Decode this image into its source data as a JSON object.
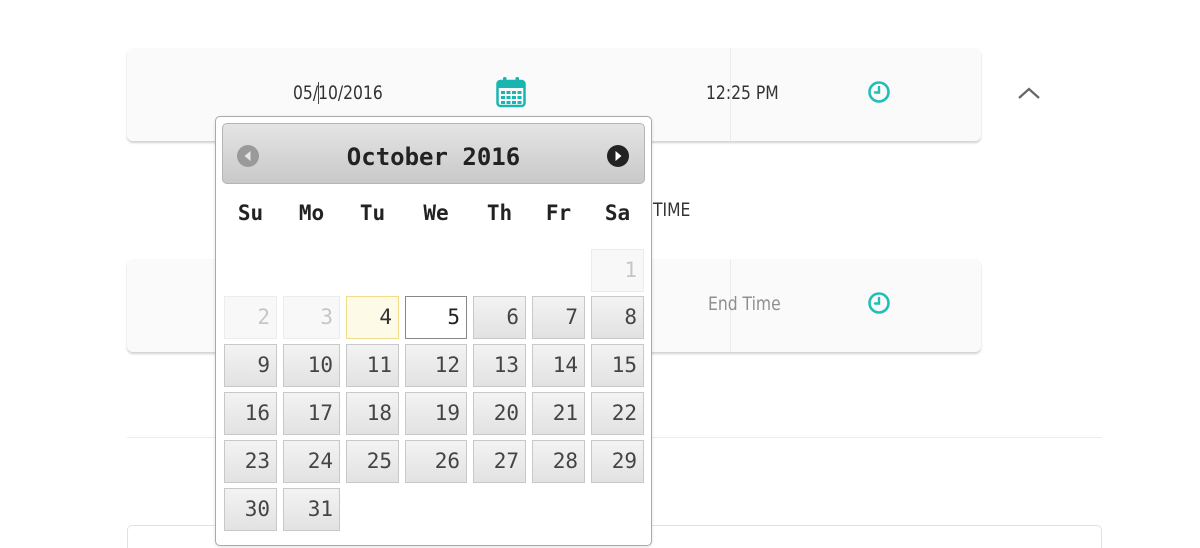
{
  "start": {
    "date_value": "05/10/2016",
    "time_value": "12:25 PM",
    "icons": {
      "calendar": "calendar-icon",
      "clock": "clock-icon",
      "collapse": "chevron-up-icon"
    }
  },
  "end": {
    "time_placeholder": "End Time",
    "icons": {
      "clock": "clock-icon"
    }
  },
  "time_section_label": "TIME",
  "colors": {
    "accent": "#19b5b0",
    "clock": "#1fbfb8"
  },
  "datepicker": {
    "month_title": "October 2016",
    "prev_icon": "prev-month-icon",
    "next_icon": "next-month-icon",
    "weekdays": [
      "Su",
      "Mo",
      "Tu",
      "We",
      "Th",
      "Fr",
      "Sa"
    ],
    "today": "4",
    "selected": "5",
    "weeks": [
      [
        "",
        "",
        "",
        "",
        "",
        "",
        "1"
      ],
      [
        "2",
        "3",
        "4",
        "5",
        "6",
        "7",
        "8"
      ],
      [
        "9",
        "10",
        "11",
        "12",
        "13",
        "14",
        "15"
      ],
      [
        "16",
        "17",
        "18",
        "19",
        "20",
        "21",
        "22"
      ],
      [
        "23",
        "24",
        "25",
        "26",
        "27",
        "28",
        "29"
      ],
      [
        "30",
        "31",
        "",
        "",
        "",
        "",
        ""
      ]
    ]
  }
}
